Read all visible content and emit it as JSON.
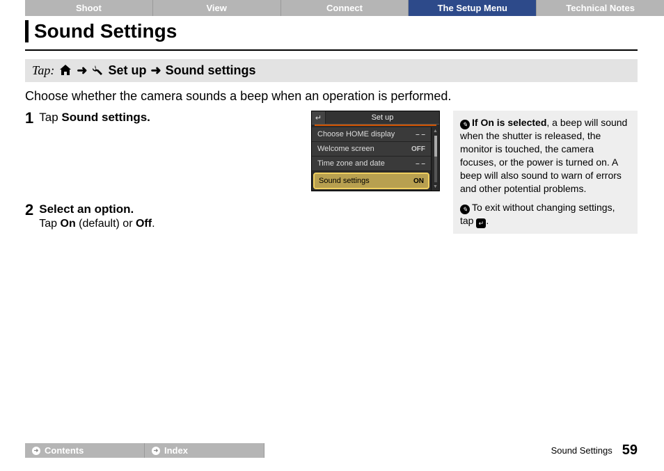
{
  "tabs": [
    "Shoot",
    "View",
    "Connect",
    "The Setup Menu",
    "Technical Notes"
  ],
  "active_tab_index": 3,
  "page_title": "Sound Settings",
  "breadcrumb": {
    "tap_label": "Tap:",
    "setup": "Set up",
    "sound_settings": "Sound settings"
  },
  "intro": "Choose whether the camera sounds a beep when an operation is performed.",
  "steps": {
    "s1": {
      "num": "1",
      "text_prefix": "Tap ",
      "text_strong": "Sound settings."
    },
    "s2": {
      "num": "2",
      "text_strong": "Select an option.",
      "sub_prefix": "Tap ",
      "sub_on": "On",
      "sub_mid": " (default) or ",
      "sub_off": "Off",
      "sub_end": "."
    }
  },
  "screen": {
    "title": "Set up",
    "rows": [
      {
        "label": "Choose HOME display",
        "value": "– –"
      },
      {
        "label": "Welcome screen",
        "value": "OFF"
      },
      {
        "label": "Time zone and date",
        "value": "– –"
      },
      {
        "label": "Sound settings",
        "value": "ON",
        "highlight": true
      }
    ]
  },
  "notes": {
    "pencil_icon": "✎",
    "n1_strong": "If On is selected",
    "n1_rest": ", a beep will sound when the shutter is released, the monitor is touched, the camera focuses, or the power is turned on. A beep will also sound to warn of errors and other potential problems.",
    "n2_prefix": "To exit without changing settings, tap ",
    "n2_icon": "↵",
    "n2_end": "."
  },
  "footer": {
    "contents": "Contents",
    "index": "Index",
    "caption": "Sound Settings",
    "page": "59"
  }
}
